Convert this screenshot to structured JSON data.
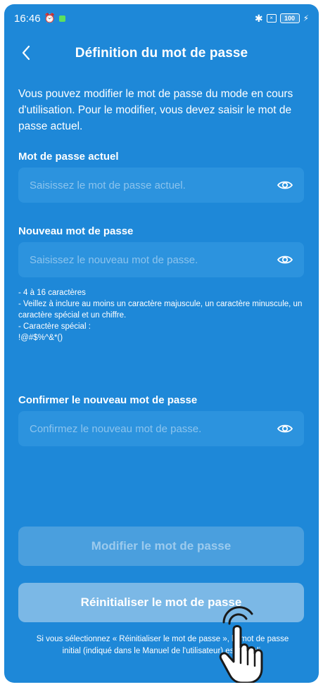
{
  "status_bar": {
    "time": "16:46",
    "battery": "100"
  },
  "header": {
    "title": "Définition du mot de passe"
  },
  "intro": "Vous pouvez modifier le mot de passe du mode en cours d'utilisation. Pour le modifier, vous devez saisir le mot de passe actuel.",
  "current_password": {
    "label": "Mot de passe actuel",
    "placeholder": "Saisissez le mot de passe actuel."
  },
  "new_password": {
    "label": "Nouveau mot de passe",
    "placeholder": "Saisissez le nouveau mot de passe."
  },
  "rules": [
    "- 4 à 16 caractères",
    "- Veillez à inclure au moins un caractère majuscule, un caractère minuscule, un caractère spécial et un chiffre.",
    "- Caractère spécial :",
    "!@#$%^&*()"
  ],
  "confirm_password": {
    "label": "Confirmer le nouveau mot de passe",
    "placeholder": "Confirmez le nouveau mot de passe."
  },
  "buttons": {
    "modify": "Modifier le mot de passe",
    "reset": "Réinitialiser le mot de passe"
  },
  "note": "Si vous sélectionnez « Réinitialiser le mot de passe », le mot de passe initial (indiqué dans le Manuel de l'utilisateur) est rétabli.",
  "icons": {
    "back": "chevron-left-icon",
    "eye": "eye-icon",
    "hand": "hand-pointer-icon"
  },
  "colors": {
    "background": "#1e88d8",
    "input": "#2c93de",
    "button_disabled": "#4a9fde",
    "button_reset": "#7bb8e6"
  }
}
